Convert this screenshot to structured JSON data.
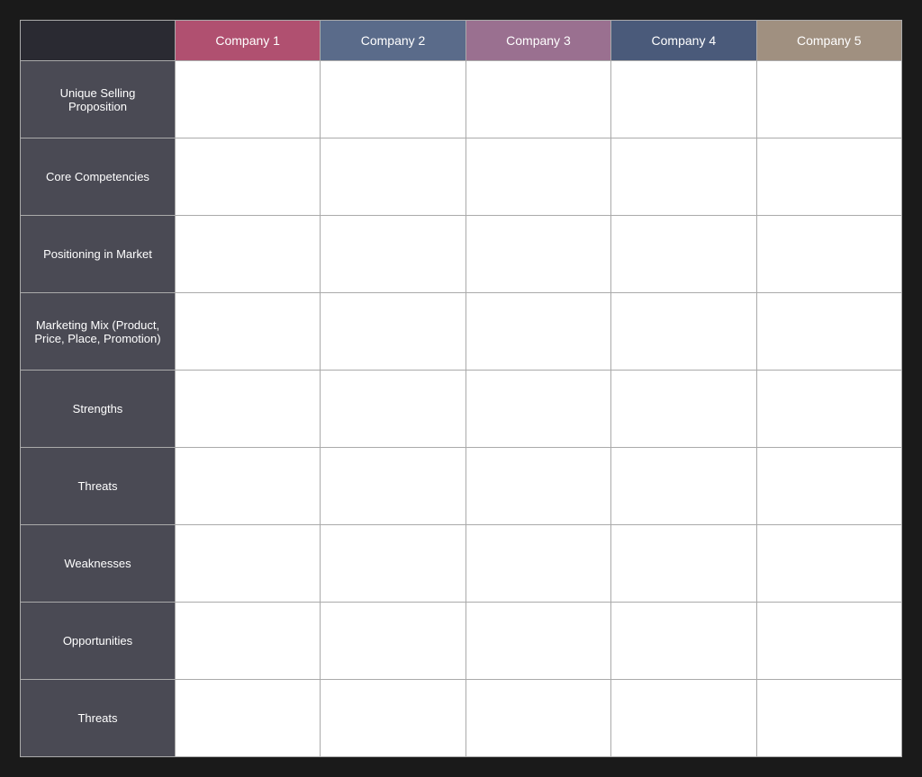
{
  "header": {
    "companies": [
      {
        "id": "company1",
        "label": "Company 1",
        "colorClass": "col-company1"
      },
      {
        "id": "company2",
        "label": "Company 2",
        "colorClass": "col-company2"
      },
      {
        "id": "company3",
        "label": "Company 3",
        "colorClass": "col-company3"
      },
      {
        "id": "company4",
        "label": "Company 4",
        "colorClass": "col-company4"
      },
      {
        "id": "company5",
        "label": "Company 5",
        "colorClass": "col-company5"
      }
    ]
  },
  "rows": [
    {
      "id": "unique-selling-proposition",
      "label": "Unique Selling Proposition"
    },
    {
      "id": "core-competencies",
      "label": "Core Competencies"
    },
    {
      "id": "positioning-in-market",
      "label": "Positioning in Market"
    },
    {
      "id": "marketing-mix",
      "label": "Marketing Mix (Product, Price, Place, Promotion)"
    },
    {
      "id": "strengths",
      "label": "Strengths"
    },
    {
      "id": "threats-1",
      "label": "Threats"
    },
    {
      "id": "weaknesses",
      "label": "Weaknesses"
    },
    {
      "id": "opportunities",
      "label": "Opportunities"
    },
    {
      "id": "threats-2",
      "label": "Threats"
    }
  ]
}
